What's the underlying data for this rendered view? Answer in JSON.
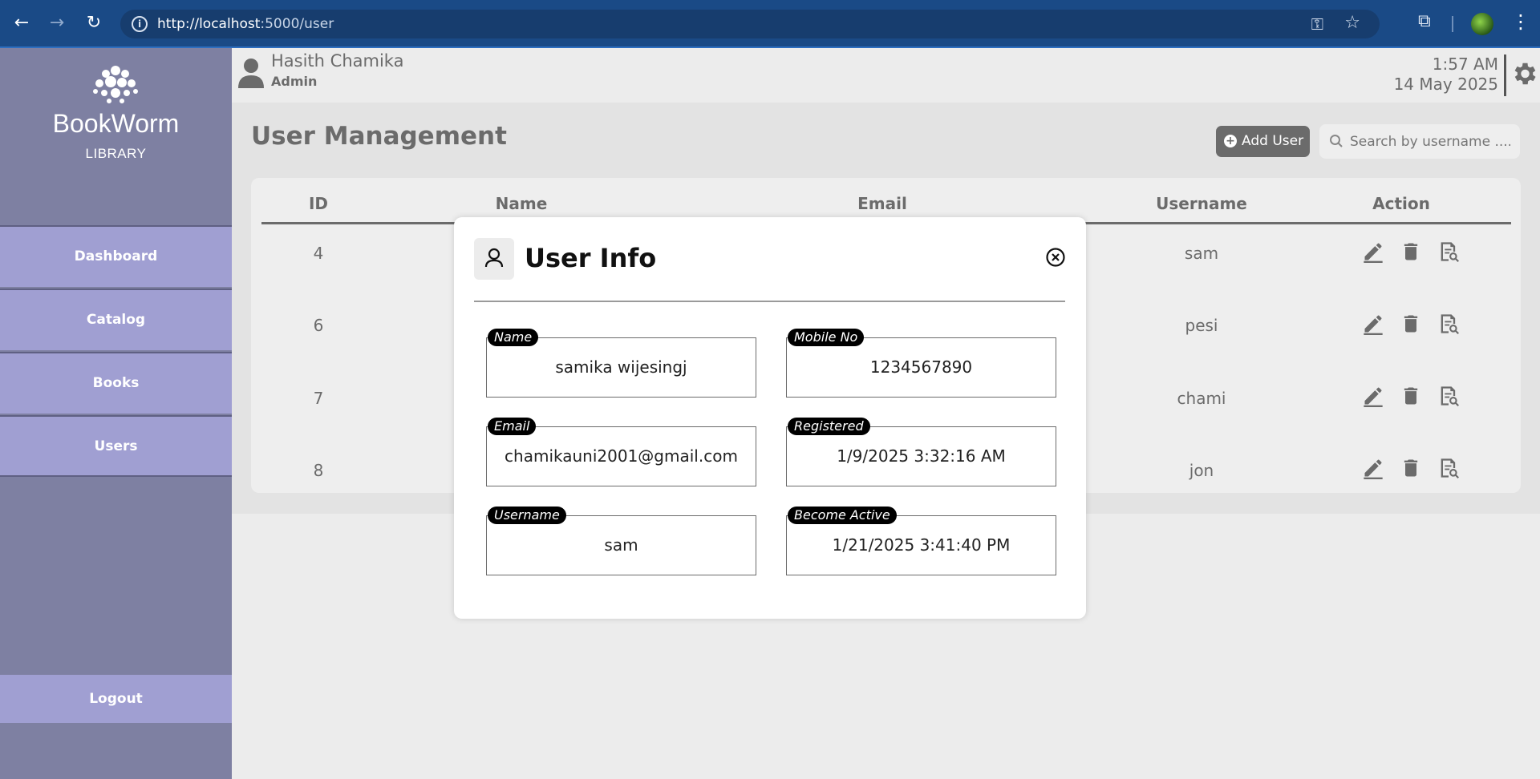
{
  "browser": {
    "url_host": "http://localhost",
    "url_rest": ":5000/user"
  },
  "sidebar": {
    "brand_title": "BookWorm",
    "brand_subtitle": "LIBRARY",
    "items": [
      {
        "label": "Dashboard"
      },
      {
        "label": "Catalog"
      },
      {
        "label": "Books"
      },
      {
        "label": "Users"
      }
    ],
    "logout_label": "Logout"
  },
  "header": {
    "user_name": "Hasith Chamika",
    "user_role": "Admin",
    "time": "1:57 AM",
    "date": "14 May 2025"
  },
  "main": {
    "title": "User Management",
    "add_user_label": "Add User",
    "search_placeholder": "Search by username ....",
    "columns": [
      "ID",
      "Name",
      "Email",
      "Username",
      "Action"
    ],
    "rows": [
      {
        "id": "4",
        "username": "sam"
      },
      {
        "id": "6",
        "username": "pesi"
      },
      {
        "id": "7",
        "username": "chami"
      },
      {
        "id": "8",
        "username": "jon"
      }
    ]
  },
  "modal": {
    "title": "User Info",
    "fields": {
      "name": {
        "label": "Name",
        "value": "samika wijesingj"
      },
      "mobile": {
        "label": "Mobile No",
        "value": "1234567890"
      },
      "email": {
        "label": "Email",
        "value": "chamikauni2001@gmail.com"
      },
      "registered": {
        "label": "Registered",
        "value": "1/9/2025 3:32:16 AM"
      },
      "username": {
        "label": "Username",
        "value": "sam"
      },
      "active": {
        "label": "Become Active",
        "value": "1/21/2025 3:41:40 PM"
      }
    }
  },
  "colors": {
    "sidebar_bg": "#7e80a2",
    "nav_item_bg": "#a09fd2",
    "browser_bar": "#1a4a86",
    "text_gray": "#6b6b6b"
  },
  "icons": [
    "back-icon",
    "forward-icon",
    "reload-icon",
    "site-info-icon",
    "key-icon",
    "star-icon",
    "extensions-icon",
    "profile-icon",
    "menu-icon",
    "logo-icon",
    "user-avatar-icon",
    "gear-icon",
    "plus-icon",
    "search-icon",
    "edit-icon",
    "delete-icon",
    "view-icon",
    "person-icon",
    "close-icon"
  ]
}
